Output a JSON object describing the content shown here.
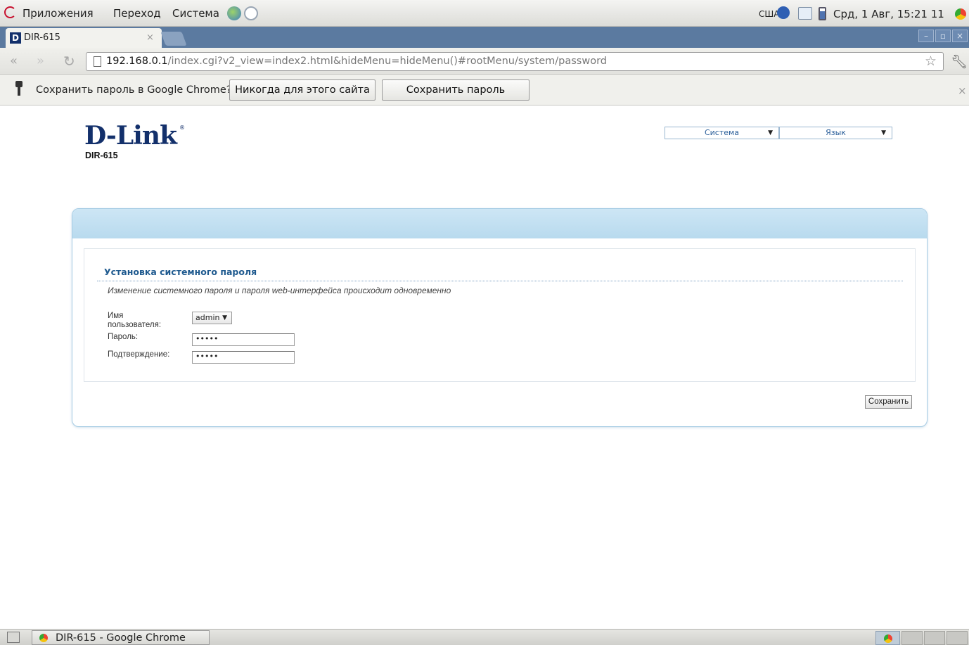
{
  "panel": {
    "menus": [
      "Приложения",
      "Переход",
      "Система"
    ],
    "layout": "США",
    "clock": "Срд, 1 Авг, 15:21 11"
  },
  "browser": {
    "tab_title": "DIR-615",
    "url_host": "192.168.0.1",
    "url_path": "/index.cgi?v2_view=index2.html&hideMenu=hideMenu()#rootMenu/system/password",
    "infobar_text": "Сохранить пароль в Google Chrome?",
    "never_label": "Никогда для этого сайта",
    "save_label": "Сохранить пароль"
  },
  "router": {
    "logo": "D-Link",
    "model": "DIR-615",
    "menu_system": "Система",
    "menu_language": "Язык",
    "section_title": "Установка системного пароля",
    "section_desc": "Изменение системного пароля и пароля web-интерфейса происходит одновременно",
    "username_label_1": "Имя",
    "username_label_2": "пользователя:",
    "username_value": "admin",
    "password_label": "Пароль:",
    "password_value": "•••••",
    "confirm_label": "Подтверждение:",
    "confirm_value": "•••••",
    "save_button": "Сохранить"
  },
  "taskbar": {
    "window_title": "DIR-615 - Google Chrome"
  }
}
